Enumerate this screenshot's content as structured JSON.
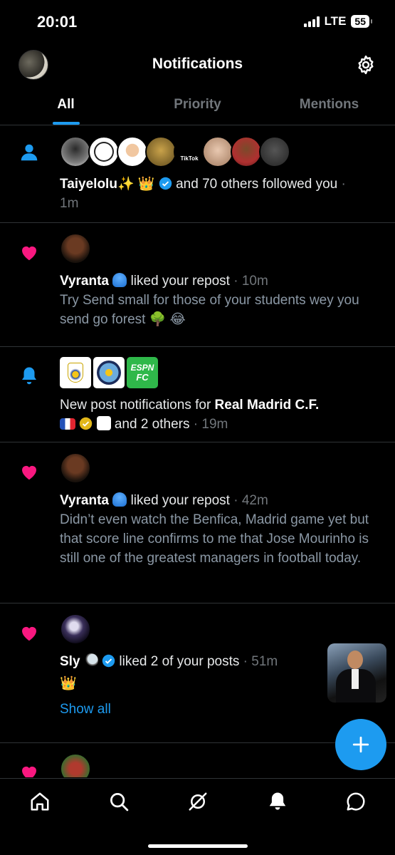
{
  "status": {
    "time": "20:01",
    "network": "LTE",
    "battery": "55"
  },
  "header": {
    "title": "Notifications"
  },
  "tabs": [
    {
      "label": "All"
    },
    {
      "label": "Priority"
    },
    {
      "label": "Mentions"
    }
  ],
  "notifications": [
    {
      "type": "follow",
      "icon": "person-icon",
      "name": "Taiyelolu✨ 👑",
      "verified": true,
      "text": "and 70 others followed you",
      "time": "1m",
      "avatar_tiktok_label": "TikTok"
    },
    {
      "type": "like",
      "icon": "heart-icon",
      "name": "Vyranta",
      "action": "liked your repost",
      "time": "10m",
      "body": "Try Send small for those of your students wey you send go forest 🌳 😂"
    },
    {
      "type": "new-post",
      "icon": "bell-icon",
      "prefix": "New post notifications for",
      "name": "Real Madrid C.F.",
      "suffix": "and 2 others",
      "time": "19m",
      "espn_label": "ESPN",
      "espn_sub": "FC"
    },
    {
      "type": "like",
      "icon": "heart-icon",
      "name": "Vyranta",
      "action": "liked your repost",
      "time": "42m",
      "body": "Didn’t even watch the Benfica, Madrid game yet but that score line confirms to me that Jose Mourinho is still one of the greatest managers in football today."
    },
    {
      "type": "like",
      "icon": "heart-icon",
      "name": "Sly",
      "verified": true,
      "action": "liked 2 of your posts",
      "time": "51m",
      "body": "👑",
      "link": "Show all"
    }
  ],
  "colors": {
    "accent": "#1d9bf0",
    "heart": "#f91880",
    "muted": "#71767b",
    "divider": "#2f3336"
  }
}
